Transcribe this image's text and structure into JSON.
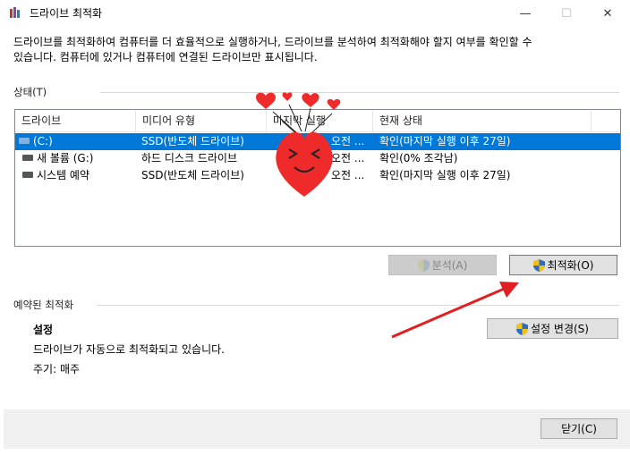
{
  "window": {
    "title": "드라이브 최적화",
    "controls": {
      "minimize": "—",
      "maximize": "☐",
      "close": "✕"
    }
  },
  "description": {
    "line1": "드라이브를 최적화하여 컴퓨터를 더 효율적으로 실행하거나, 드라이브를 분석하여 최적화해야 할지 여부를 확인할 수",
    "line2": "있습니다. 컴퓨터에 있거나 컴퓨터에 연결된 드라이브만 표시됩니다."
  },
  "status_group": {
    "label": "상태(T)",
    "columns": [
      "드라이브",
      "미디어 유형",
      "마지막 실행",
      "현재 상태"
    ],
    "rows": [
      {
        "drive": "(C:)",
        "media": "SSD(반도체 드라이브)",
        "last_run": "오전 ...",
        "status": "확인(마지막 실행 이후 27일)",
        "selected": true
      },
      {
        "drive": "새 볼륨 (G:)",
        "media": "하드 디스크 드라이브",
        "last_run": "오전 ...",
        "status": "확인(0% 조각남)",
        "selected": false
      },
      {
        "drive": "시스템 예약",
        "media": "SSD(반도체 드라이브)",
        "last_run": "오전 ...",
        "status": "확인(마지막 실행 이후 27일)",
        "selected": false
      }
    ]
  },
  "buttons": {
    "analyze": "분석(A)",
    "optimize": "최적화(O)",
    "change_settings": "설정 변경(S)",
    "close": "닫기(C)"
  },
  "scheduled": {
    "label": "예약된 최적화",
    "heading": "설정",
    "status_text": "드라이브가 자동으로 최적화되고 있습니다.",
    "frequency": "주기: 매주"
  },
  "colors": {
    "selection": "#0078d7",
    "arrow": "#e02020",
    "heart": "#ee2a2a"
  }
}
